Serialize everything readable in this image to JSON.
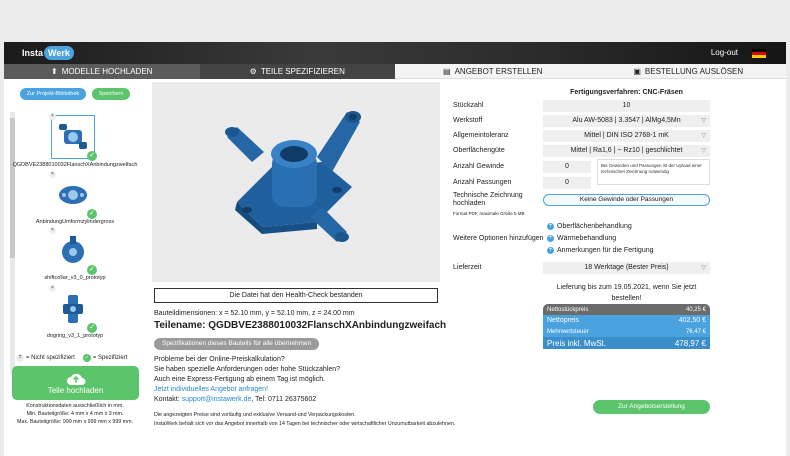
{
  "brand": {
    "insta": "Insta",
    "werk": "Werk"
  },
  "header": {
    "logout": "Log-out",
    "flag_icon": "german-flag-icon"
  },
  "steps": [
    {
      "label": "MODELLE HOCHLADEN",
      "icon": "upload-circle-icon"
    },
    {
      "label": "TEILE SPEZIFIZIEREN",
      "icon": "gear-icon"
    },
    {
      "label": "ANGEBOT ERSTELLEN",
      "icon": "document-icon"
    },
    {
      "label": "BESTELLUNG AUSLÖSEN",
      "icon": "cart-icon"
    }
  ],
  "sidebar": {
    "library_button": "Zur Projekt-Bibliothek",
    "save_button": "Speichern",
    "parts": [
      {
        "name": "QGDBVE2388010032FlanschXAnbindungzweifach",
        "selected": true
      },
      {
        "name": "AnbindungUmformzylindergross",
        "selected": false
      },
      {
        "name": "shiftcollar_v3_0_prototyp",
        "selected": false
      },
      {
        "name": "dogring_v3_1_prototyp",
        "selected": false
      }
    ],
    "legend_unspec": "= Nicht spezifiziert",
    "legend_spec": "= Spezifiziert",
    "upload_label": "Teile hochladen",
    "upload_note_1": "Konstruktionsdaten ausschließlich in mm.",
    "upload_note_2": "Min. Bauteilgröße: 4 mm x 4 mm x 3 mm.",
    "upload_note_3": "Max. Bauteilgröße: 999 mm x 999 mm x 999 mm."
  },
  "middle": {
    "health_check": "Die Datei hat den Health-Check bestanden",
    "dimensions": "Bauteildimensionen: x = 52.10 mm, y = 52.10 mm, z = 24.00 mm",
    "part_title": "Teilename: QGDBVE2388010032FlanschXAnbindungzweifach",
    "apply_all_button": "Spezifikationen dieses Bauteils für alle übernehmen",
    "problem_1": "Probleme bei der Online-Preiskalkulation?",
    "problem_2": "Sie haben spezielle Anforderungen oder hohe Stückzahlen?",
    "problem_3": "Auch eine Express-Fertigung ab einem Tag ist möglich.",
    "individual_link": "Jetzt individuelles Angebot anfragen!",
    "contact_prefix": "Kontakt: ",
    "contact_email": "support@instawerk.de",
    "contact_suffix": ", Tel: 0711 26375602",
    "disclaimer_1": "Die angezeigten Preise sind vorläufig und exklusive Versand-und Verpackungskosten.",
    "disclaimer_2": "InstaWerk behält sich vor das Angebot innerhalb von 14 Tagen bei technischer oder wirtschaftlicher Unzumutbarkeit abzulehnen."
  },
  "spec": {
    "process_title": "Fertigungsverfahren: CNC-Fräsen",
    "labels": {
      "quantity": "Stückzahl",
      "material": "Werkstoff",
      "tolerance": "Allgemeintoleranz",
      "surface": "Oberflächengüte",
      "threads": "Anzahl Gewinde",
      "fits": "Anzahl Passungen",
      "drawing": "Technische Zeichnung hochladen",
      "drawing_note": "Format PDF, maximale Größe 5 MB",
      "options": "Weitere Optionen hinzufügen",
      "delivery": "Lieferzeit"
    },
    "quantity": "10",
    "material": "Alu AW-5083 | 3.3547 | AlMg4,5Mn",
    "tolerance": "Mittel | DIN ISO 2768-1 mK",
    "surface": "Mittel | Ra1,6 | ~ Rz10 | geschlichtet",
    "threads": "0",
    "fits": "0",
    "threads_hint": "Bei Gewinden und Passungen ist der Upload einer technischen Zeichnung notwendig",
    "drawing_button": "Keine Gewinde oder Passungen",
    "options": [
      "Oberflächenbehandlung",
      "Wärmebehandlung",
      "Anmerkungen für die Fertigung"
    ],
    "delivery": "18 Werktage (Bester Preis)",
    "delivery_note": "Lieferung bis zum 19.05.2021, wenn Sie jetzt bestellen!",
    "prices": [
      {
        "label": "Nettostückpreis",
        "value": "40,25 €",
        "color": "#6b6b6b"
      },
      {
        "label": "Nettopreis",
        "value": "402,50 €",
        "color": "#4aa3df"
      },
      {
        "label": "Mehrwertsteuer",
        "value": "76,47 €",
        "color": "#4aa3df"
      },
      {
        "label": "Preis inkl. MwSt.",
        "value": "478,97 €",
        "color": "#3a8fcb"
      }
    ],
    "quote_button": "Zur Angebotserstellung"
  }
}
